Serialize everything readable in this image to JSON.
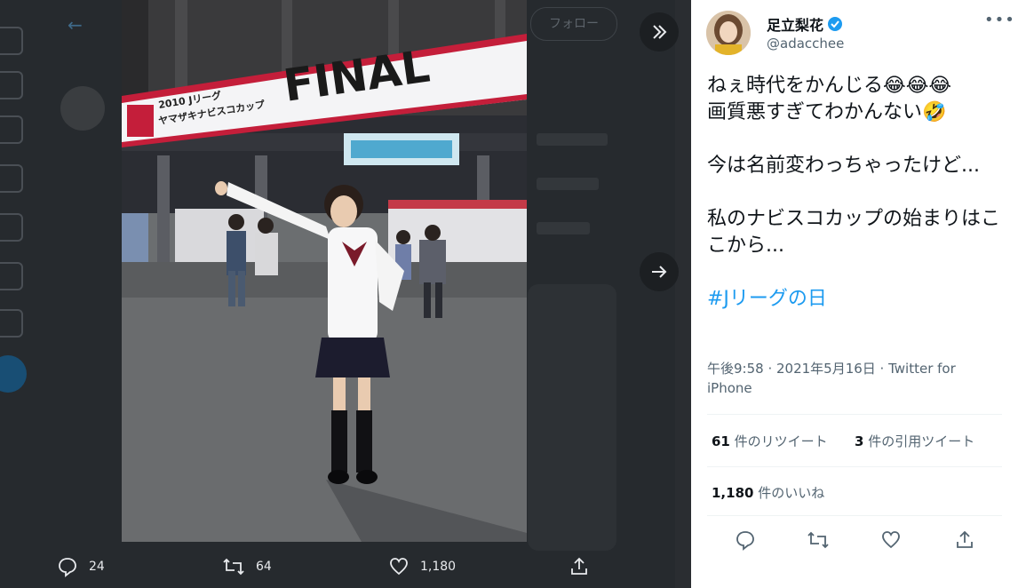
{
  "background": {
    "follow_label": "フォロー"
  },
  "photo": {
    "banner_year_text": "2010 Jリーグ",
    "banner_cup_text": "ヤマザキナビスコカップ",
    "banner_final_text": "FINAL"
  },
  "actions": {
    "reply_count": "24",
    "retweet_count": "64",
    "like_count": "1,180"
  },
  "tweet": {
    "display_name": "足立梨花",
    "handle": "@adacchee",
    "lines": [
      "ねぇ時代をかんじる😂😂😂",
      "画質悪すぎてわかんない🤣",
      "",
      "今は名前変わっちゃったけど...",
      "",
      "私のナビスコカップの始まりはここから..."
    ],
    "hashtag": "#Jリーグの日",
    "timestamp": "午後9:58 · 2021年5月16日 · Twitter for iPhone",
    "retweets_num": "61",
    "retweets_label": "件のリツイート",
    "quotes_num": "3",
    "quotes_label": "件の引用ツイート",
    "likes_num": "1,180",
    "likes_label": "件のいいね"
  },
  "colors": {
    "accent": "#1d9bf0",
    "overlay": "#262a2e"
  }
}
